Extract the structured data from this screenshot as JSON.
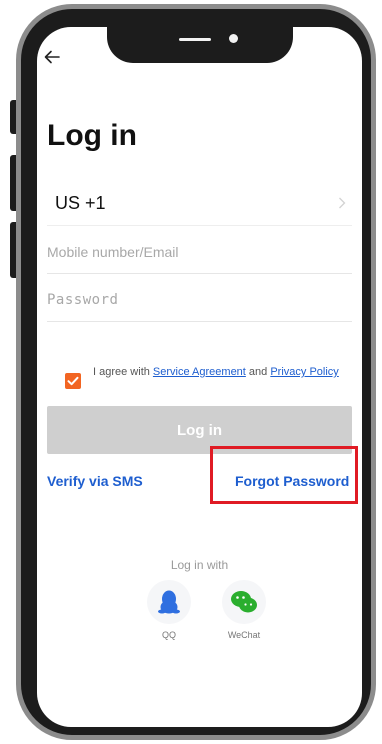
{
  "header": {
    "back_icon": "arrow-left-icon",
    "title": "Log in"
  },
  "form": {
    "country_code": "US +1",
    "mobile_placeholder": "Mobile number/Email",
    "password_placeholder": "Password",
    "agreement": {
      "checked": true,
      "prefix": "I agree with ",
      "service_link": "Service Agreement",
      "middle": " and ",
      "privacy_link": "Privacy Policy"
    },
    "login_button": "Log in"
  },
  "links": {
    "verify_sms": "Verify via SMS",
    "forgot_password": "Forgot Password"
  },
  "social": {
    "heading": "Log in with",
    "items": [
      {
        "label": "QQ",
        "icon": "qq-penguin-icon"
      },
      {
        "label": "WeChat",
        "icon": "wechat-icon"
      }
    ]
  },
  "colors": {
    "accent": "#1e5ecf",
    "checkbox": "#f26522",
    "highlight": "#e01b24",
    "disabled_button": "#cfcfcf"
  }
}
